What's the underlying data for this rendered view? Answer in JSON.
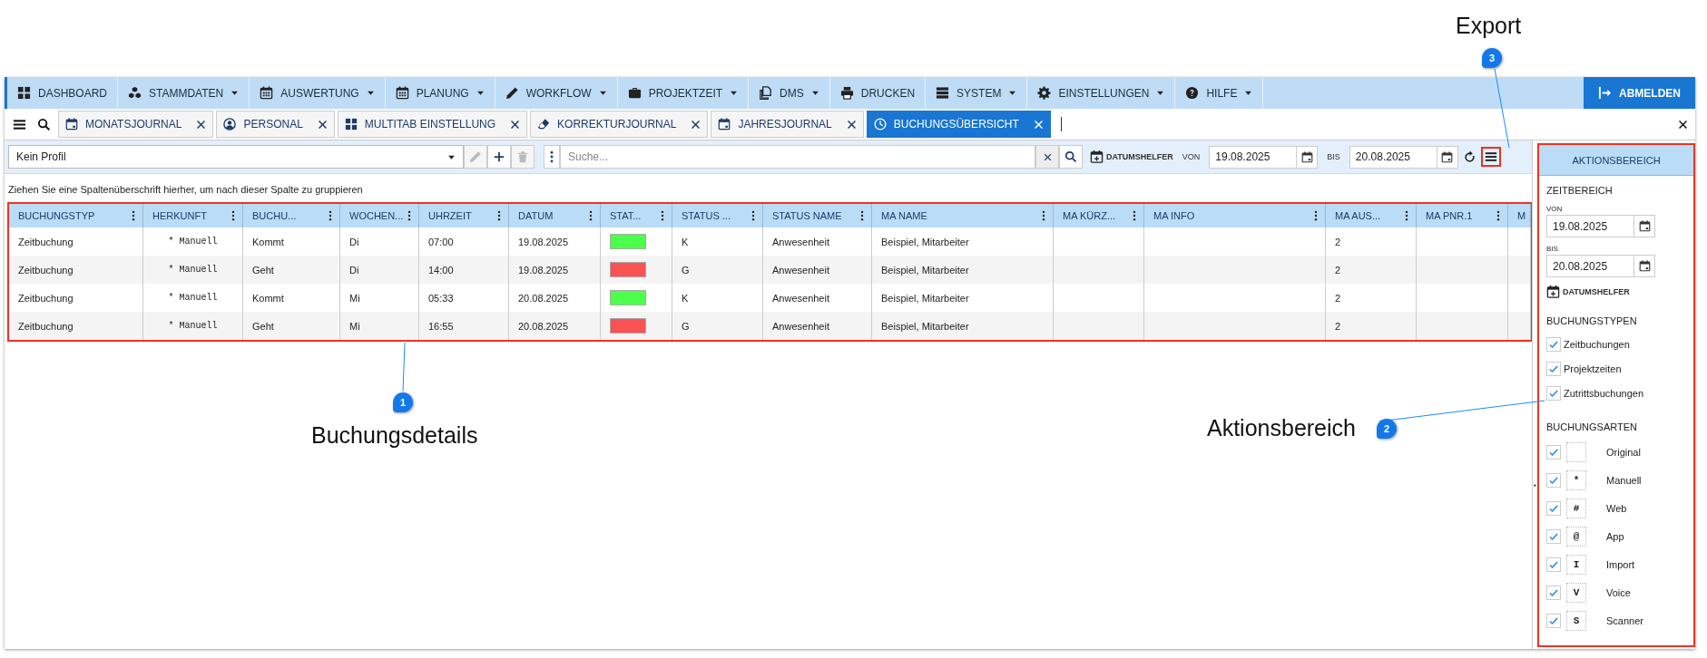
{
  "nav": {
    "items": [
      {
        "label": "DASHBOARD",
        "dropdown": false
      },
      {
        "label": "STAMMDATEN",
        "dropdown": true
      },
      {
        "label": "AUSWERTUNG",
        "dropdown": true
      },
      {
        "label": "PLANUNG",
        "dropdown": true
      },
      {
        "label": "WORKFLOW",
        "dropdown": true
      },
      {
        "label": "PROJEKTZEIT",
        "dropdown": true
      },
      {
        "label": "DMS",
        "dropdown": true
      },
      {
        "label": "DRUCKEN",
        "dropdown": false
      },
      {
        "label": "SYSTEM",
        "dropdown": true
      },
      {
        "label": "EINSTELLUNGEN",
        "dropdown": true
      },
      {
        "label": "HILFE",
        "dropdown": true
      }
    ],
    "logout": "ABMELDEN"
  },
  "tabs": [
    {
      "label": "MONATSJOURNAL",
      "selected": false
    },
    {
      "label": "PERSONAL",
      "selected": false
    },
    {
      "label": "MULTITAB EINSTELLUNG",
      "selected": false
    },
    {
      "label": "KORREKTURJOURNAL",
      "selected": false
    },
    {
      "label": "JAHRESJOURNAL",
      "selected": false
    },
    {
      "label": "BUCHUNGSÜBERSICHT",
      "selected": true
    }
  ],
  "toolbar": {
    "profile": "Kein Profil",
    "edit_disabled": true,
    "delete_disabled": true,
    "search_placeholder": "Suche...",
    "date_helper": "DATUMSHELFER",
    "from_label": "VON",
    "from": "19.08.2025",
    "to_label": "BIS",
    "to": "20.08.2025"
  },
  "group_hint": "Ziehen Sie eine Spaltenüberschrift hierher, um nach dieser Spalte zu gruppieren",
  "table": {
    "columns": [
      {
        "label": "BUCHUNGSTYP",
        "kind": "text"
      },
      {
        "label": "HERKUNFT",
        "kind": "mono"
      },
      {
        "label": "BUCHU...",
        "kind": "text"
      },
      {
        "label": "WOCHEN...",
        "kind": "text"
      },
      {
        "label": "UHRZEIT",
        "kind": "text"
      },
      {
        "label": "DATUM",
        "kind": "text"
      },
      {
        "label": "STAT...",
        "kind": "color"
      },
      {
        "label": "STATUS ...",
        "kind": "text"
      },
      {
        "label": "STATUS NAME",
        "kind": "text"
      },
      {
        "label": "MA NAME",
        "kind": "text"
      },
      {
        "label": "MA KÜRZ...",
        "kind": "text"
      },
      {
        "label": "MA INFO",
        "kind": "text"
      },
      {
        "label": "MA AUS...",
        "kind": "text"
      },
      {
        "label": "MA PNR.1",
        "kind": "text"
      },
      {
        "label": "M",
        "kind": "text"
      }
    ],
    "rows": [
      {
        "cells": [
          "Zeitbuchung",
          "* Manuell",
          "Kommt",
          "Di",
          "07:00",
          "19.08.2025",
          "",
          "K",
          "Anwesenheit",
          "Beispiel, Mitarbeiter",
          "",
          "",
          "2"
        ],
        "color": "#4cff4c"
      },
      {
        "cells": [
          "Zeitbuchung",
          "* Manuell",
          "Geht",
          "Di",
          "14:00",
          "19.08.2025",
          "",
          "G",
          "Anwesenheit",
          "Beispiel, Mitarbeiter",
          "",
          "",
          "2"
        ],
        "color": "#fa5252"
      },
      {
        "cells": [
          "Zeitbuchung",
          "* Manuell",
          "Kommt",
          "Mi",
          "05:33",
          "20.08.2025",
          "",
          "K",
          "Anwesenheit",
          "Beispiel, Mitarbeiter",
          "",
          "",
          "2"
        ],
        "color": "#4cff4c"
      },
      {
        "cells": [
          "Zeitbuchung",
          "* Manuell",
          "Geht",
          "Mi",
          "16:55",
          "20.08.2025",
          "",
          "G",
          "Anwesenheit",
          "Beispiel, Mitarbeiter",
          "",
          "",
          "2"
        ],
        "color": "#fa5252"
      }
    ]
  },
  "panel": {
    "title": "AKTIONSBEREICH",
    "range_heading": "ZEITBEREICH",
    "from_label": "VON",
    "from": "19.08.2025",
    "to_label": "BIS",
    "to": "20.08.2025",
    "date_helper": "DATUMSHELFER",
    "types_heading": "BUCHUNGSTYPEN",
    "types": [
      {
        "label": "Zeitbuchungen",
        "checked": true
      },
      {
        "label": "Projektzeiten",
        "checked": true
      },
      {
        "label": "Zutrittsbuchungen",
        "checked": true
      }
    ],
    "kinds_heading": "BUCHUNGSARTEN",
    "kinds": [
      {
        "label": "Original",
        "checked": true
      },
      {
        "symbol": "*",
        "label": "Manuell",
        "checked": true
      },
      {
        "symbol": "#",
        "label": "Web",
        "checked": true
      },
      {
        "symbol": "@",
        "label": "App",
        "checked": true
      },
      {
        "symbol": "I",
        "label": "Import",
        "checked": true
      },
      {
        "symbol": "V",
        "label": "Voice",
        "checked": true
      },
      {
        "symbol": "S",
        "label": "Scanner",
        "checked": true
      }
    ]
  },
  "annotations": [
    {
      "number": "1",
      "label": "Buchungsdetails"
    },
    {
      "number": "2",
      "label": "Aktionsbereich"
    },
    {
      "number": "3",
      "label": "Export"
    }
  ]
}
